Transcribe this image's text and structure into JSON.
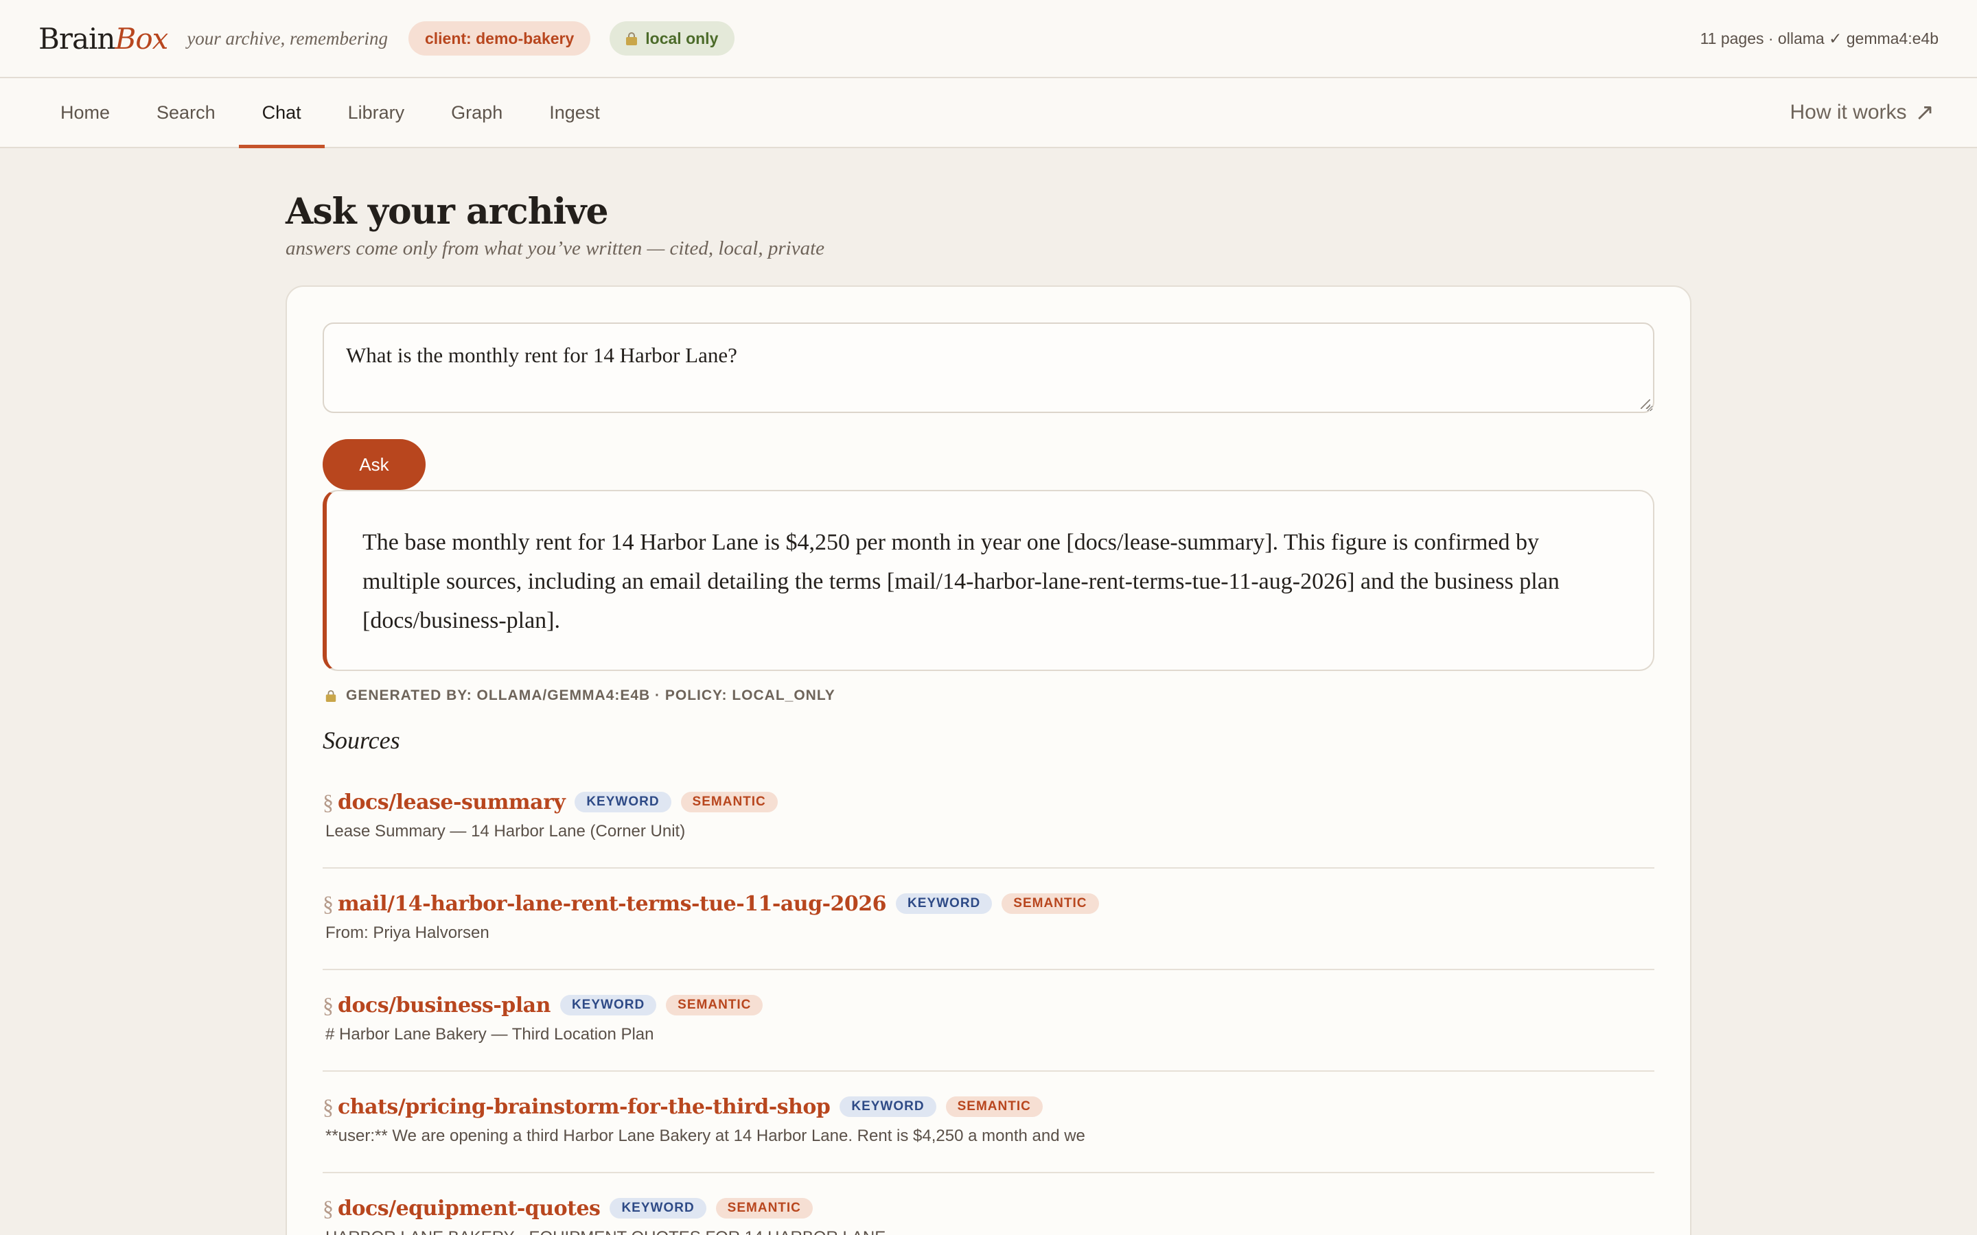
{
  "header": {
    "brand_a": "Brain",
    "brand_b": "Box",
    "tagline": "your archive, remembering",
    "client_pill": "client: demo-bakery",
    "local_pill": "local only",
    "status": "11 pages · ollama ✓ gemma4:e4b"
  },
  "nav": {
    "tabs": [
      {
        "label": "Home"
      },
      {
        "label": "Search"
      },
      {
        "label": "Chat"
      },
      {
        "label": "Library"
      },
      {
        "label": "Graph"
      },
      {
        "label": "Ingest"
      }
    ],
    "active": "Chat",
    "how_label": "How it works",
    "how_arrow": "↗"
  },
  "page": {
    "title": "Ask your archive",
    "subtitle": "answers come only from what you’ve written — cited, local, private"
  },
  "chat": {
    "question": "What is the monthly rent for 14 Harbor Lane?",
    "ask_label": "Ask",
    "answer": "The base monthly rent for 14 Harbor Lane is $4,250 per month in year one [docs/lease-summary]. This figure is confirmed by multiple sources, including an email detailing the terms [mail/14-harbor-lane-rent-terms-tue-11-aug-2026] and the business plan [docs/business-plan].",
    "generated_by": "GENERATED BY: OLLAMA/GEMMA4:E4B · POLICY: LOCAL_ONLY",
    "sources_title": "Sources",
    "section_glyph": "§",
    "badge_keyword": "KEYWORD",
    "badge_semantic": "SEMANTIC",
    "sources": [
      {
        "path": "docs/lease-summary",
        "snippet": "Lease Summary — 14 Harbor Lane (Corner Unit)"
      },
      {
        "path": "mail/14-harbor-lane-rent-terms-tue-11-aug-2026",
        "snippet": "From: Priya Halvorsen"
      },
      {
        "path": "docs/business-plan",
        "snippet": "# Harbor Lane Bakery — Third Location Plan"
      },
      {
        "path": "chats/pricing-brainstorm-for-the-third-shop",
        "snippet": "**user:** We are opening a third Harbor Lane Bakery at 14 Harbor Lane. Rent is $4,250 a month and we"
      },
      {
        "path": "docs/equipment-quotes",
        "snippet": "HARBOR LANE BAKERY - EQUIPMENT QUOTES FOR 14 HARBOR LANE"
      }
    ]
  },
  "colors": {
    "accent": "#b8461e",
    "keyword_badge": "#2e4a86",
    "local_badge": "#4c6b2a"
  }
}
